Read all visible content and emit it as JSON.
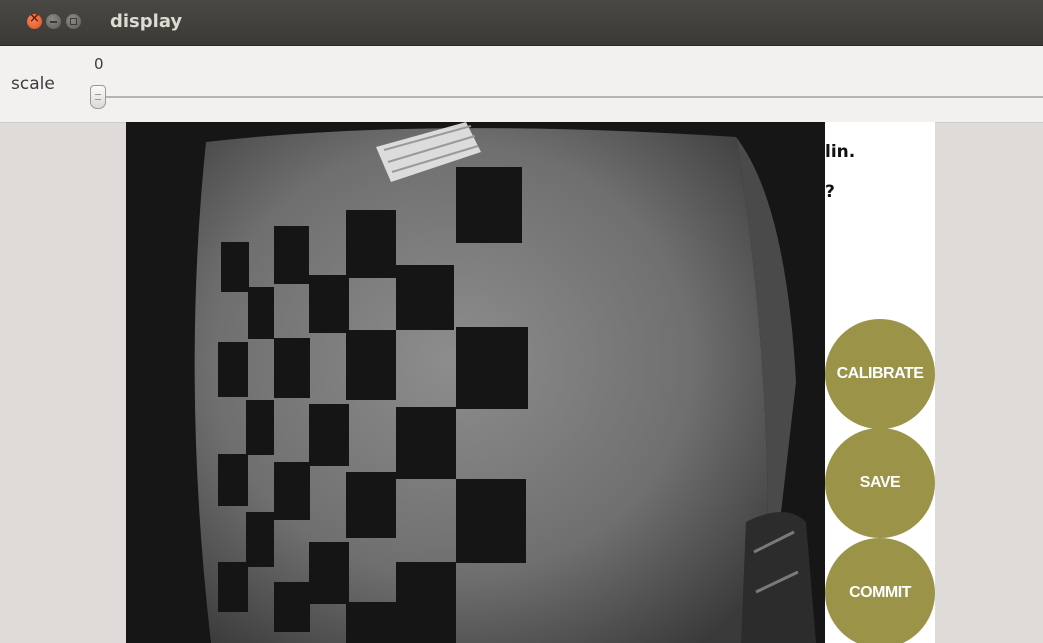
{
  "window": {
    "title": "display",
    "controls": [
      "close-icon",
      "minimize-icon",
      "maximize-icon"
    ]
  },
  "trackbar": {
    "label": "scale",
    "value": "0",
    "level": 0
  },
  "side_panel": {
    "line1": "lin.",
    "line2": "?",
    "buttons": {
      "calibrate": "CALIBRATE",
      "save": "SAVE",
      "commit": "COMMIT"
    }
  },
  "colors": {
    "button_fill": "#9a9348",
    "titlebar": "#3c3b37",
    "toolbar": "#f2f1f0",
    "window_bg": "#dedbd8"
  }
}
